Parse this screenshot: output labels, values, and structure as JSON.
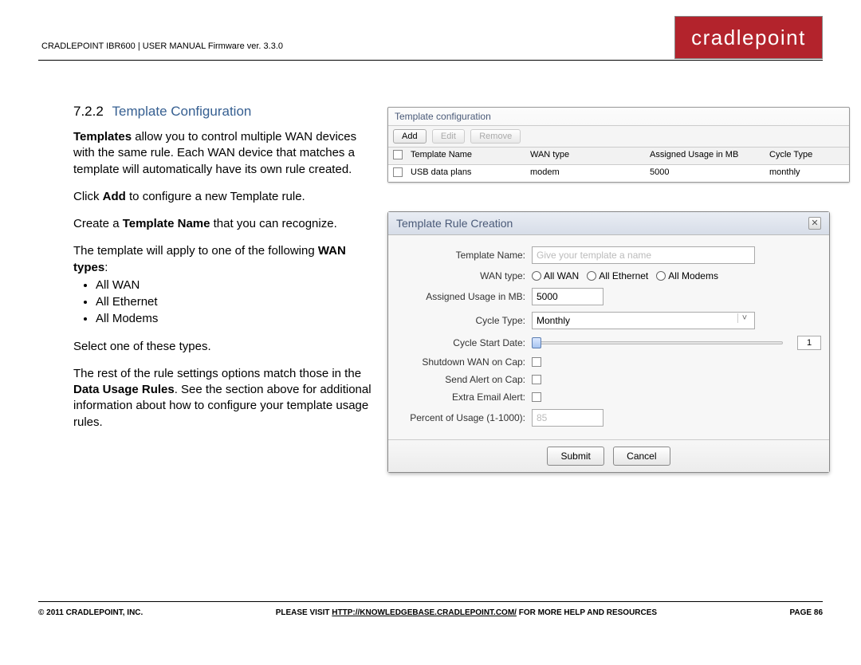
{
  "header": {
    "breadcrumb": "CRADLEPOINT IBR600 | USER MANUAL Firmware ver. 3.3.0",
    "logo": "cradlepoint"
  },
  "section": {
    "number": "7.2.2",
    "title": "Template Configuration"
  },
  "body": {
    "p1_strong": "Templates",
    "p1_rest": " allow you to control multiple WAN devices with the same rule. Each WAN device that matches a template will automatically have its own rule created.",
    "p2_a": "Click ",
    "p2_b": "Add",
    "p2_c": " to configure a new Template rule.",
    "p3_a": "Create a ",
    "p3_b": "Template Name",
    "p3_c": " that you can recognize.",
    "p4_a": "The template will apply to one of the following ",
    "p4_b": "WAN types",
    "p4_c": ":",
    "bullets": [
      "All WAN",
      "All Ethernet",
      "All Modems"
    ],
    "p5": "Select one of these types.",
    "p6_a": "The rest of the rule settings options match those in the ",
    "p6_b": "Data Usage Rules",
    "p6_c": ". See the section above for additional information about how to configure your template usage rules."
  },
  "panel1": {
    "title": "Template configuration",
    "btn_add": "Add",
    "btn_edit": "Edit",
    "btn_remove": "Remove",
    "cols": [
      "Template Name",
      "WAN type",
      "Assigned Usage in MB",
      "Cycle Type"
    ],
    "row": [
      "USB data plans",
      "modem",
      "5000",
      "monthly"
    ]
  },
  "dialog": {
    "title": "Template Rule Creation",
    "labels": {
      "name": "Template Name:",
      "wan": "WAN type:",
      "usage": "Assigned Usage in MB:",
      "cycle": "Cycle Type:",
      "start": "Cycle Start Date:",
      "shutdown": "Shutdown WAN on Cap:",
      "alert": "Send Alert on Cap:",
      "extra": "Extra Email Alert:",
      "percent": "Percent of Usage (1-1000):"
    },
    "values": {
      "name_placeholder": "Give your template a name",
      "wan_options": [
        "All WAN",
        "All Ethernet",
        "All Modems"
      ],
      "usage": "5000",
      "cycle": "Monthly",
      "start": "1",
      "percent": "85"
    },
    "buttons": {
      "submit": "Submit",
      "cancel": "Cancel"
    }
  },
  "footer": {
    "left": "© 2011 CRADLEPOINT, INC.",
    "mid_a": "PLEASE VISIT ",
    "mid_link": "HTTP://KNOWLEDGEBASE.CRADLEPOINT.COM/",
    "mid_b": " FOR MORE HELP AND RESOURCES",
    "right": "PAGE 86"
  }
}
